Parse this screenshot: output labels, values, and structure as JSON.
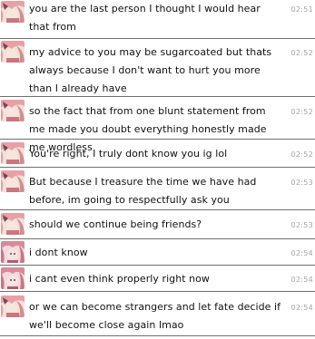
{
  "messages": [
    {
      "avatar": "avatar-a",
      "text": "you are the last person I thought I would hear that from",
      "time": "02:51"
    },
    {
      "avatar": "avatar-a",
      "text": "my advice to you may be sugarcoated but thats always because I don't want to hurt you more than I already have",
      "time": "02:52"
    },
    {
      "avatar": "avatar-a",
      "text": "so the fact that from one blunt statement from me made you doubt everything honestly made me wordless",
      "time": "02:52"
    },
    {
      "avatar": "avatar-a",
      "text": "You're right, I truly dont know you ig lol",
      "time": "02:52"
    },
    {
      "avatar": "avatar-a",
      "text": "But because I treasure the time we have had before, im going to respectfully ask you",
      "time": "02:53"
    },
    {
      "avatar": "avatar-a",
      "text": "should we continue being friends?",
      "time": "02:53"
    },
    {
      "avatar": "avatar-b",
      "text": "i dont know",
      "time": "02:54"
    },
    {
      "avatar": "avatar-b",
      "text": "i cant even think properly right now",
      "time": "02:54"
    },
    {
      "avatar": "avatar-a",
      "text": "or we can become strangers and let fate decide if we'll become close again lmao",
      "time": "02:54"
    }
  ]
}
